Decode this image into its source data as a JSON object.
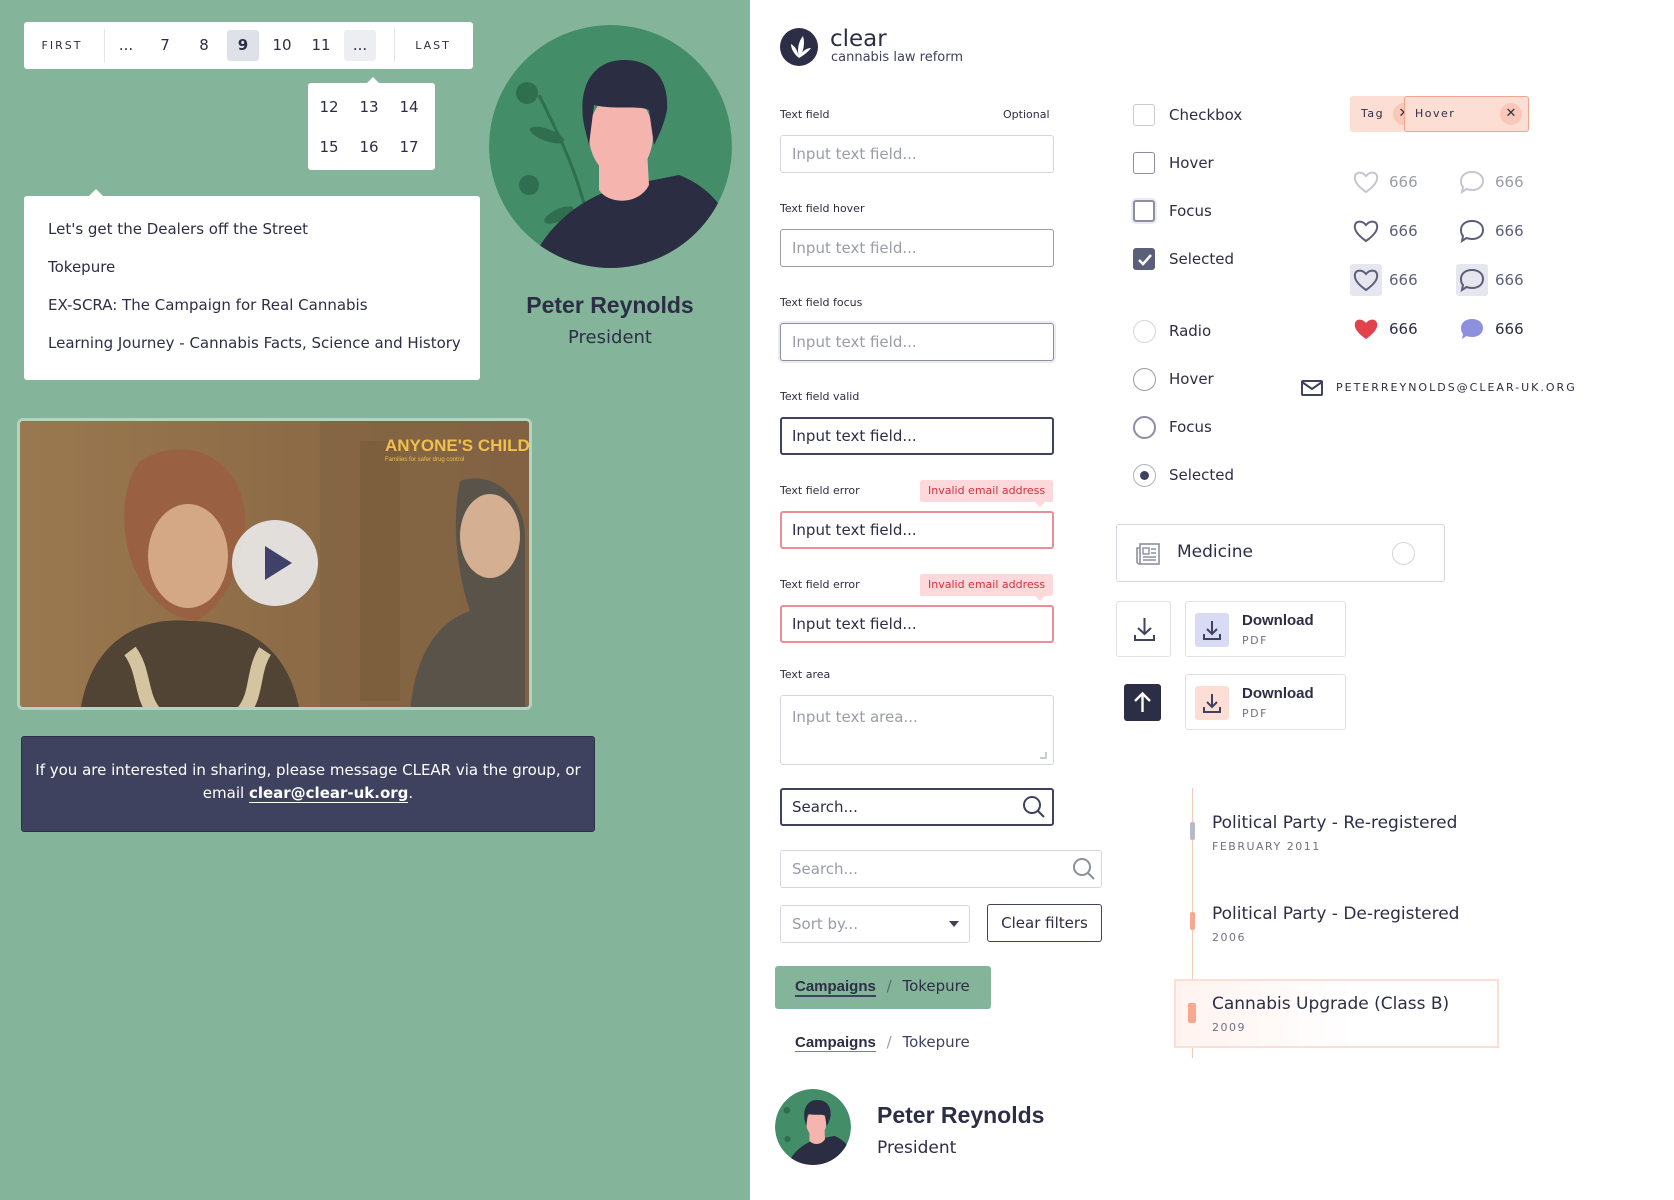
{
  "pagination": {
    "first": "FIRST",
    "last": "LAST",
    "pages": [
      "...",
      "7",
      "8",
      "9",
      "10",
      "11",
      "..."
    ],
    "active": "9",
    "menu_pages": [
      "12",
      "13",
      "14",
      "15",
      "16",
      "17"
    ]
  },
  "dropdown": {
    "items": [
      "Let's get the Dealers off the Street",
      "Tokepure",
      "EX-SCRA: The Campaign for Real Cannabis",
      "Learning Journey - Cannabis Facts, Science and History"
    ]
  },
  "profile": {
    "name": "Peter Reynolds",
    "role": "President"
  },
  "video": {
    "watermark": "ANYONE'S CHILD",
    "watermark_sub": "Families for safer drug control"
  },
  "message": {
    "text_before": "If you are interested in sharing, please message CLEAR via the group, or email ",
    "email": "clear@clear-uk.org",
    "text_after": "."
  },
  "logo": {
    "name": "clear",
    "tagline": "cannabis law reform"
  },
  "fields": {
    "text_field_label": "Text field",
    "optional_label": "Optional",
    "hover_label": "Text field hover",
    "focus_label": "Text field focus",
    "valid_label": "Text field valid",
    "error_label": "Text field error",
    "error_message": "Invalid email address",
    "placeholder": "Input text field...",
    "textarea_label": "Text area",
    "textarea_placeholder": "Input text area...",
    "search_placeholder": "Search...",
    "sort_placeholder": "Sort by...",
    "clear_filters": "Clear filters"
  },
  "checkboxes": [
    "Checkbox",
    "Hover",
    "Focus",
    "Selected"
  ],
  "radios": [
    "Radio",
    "Hover",
    "Focus",
    "Selected"
  ],
  "tags": {
    "tag": "Tag",
    "hover": "Hover"
  },
  "counters": {
    "value": "666"
  },
  "email_link": "PETERREYNOLDS@CLEAR-UK.ORG",
  "category_card": {
    "label": "Medicine"
  },
  "downloads": [
    {
      "title": "Download",
      "sub": "PDF"
    },
    {
      "title": "Download",
      "sub": "PDF"
    }
  ],
  "timeline": [
    {
      "title": "Political Party - Re-registered",
      "sub": "FEBRUARY 2011"
    },
    {
      "title": "Political Party - De-registered",
      "sub": "2006"
    },
    {
      "title": "Cannabis Upgrade (Class B)",
      "sub": "2009"
    }
  ],
  "breadcrumb": {
    "parent": "Campaigns",
    "separator": "/",
    "current": "Tokepure"
  },
  "colors": {
    "green_bg": "#84b59a",
    "navy": "#3f425f",
    "accent_peach": "#fcded4",
    "error_red": "#d0313d",
    "heart_red": "#e0434c",
    "comment_purple": "#8f8fe0"
  }
}
